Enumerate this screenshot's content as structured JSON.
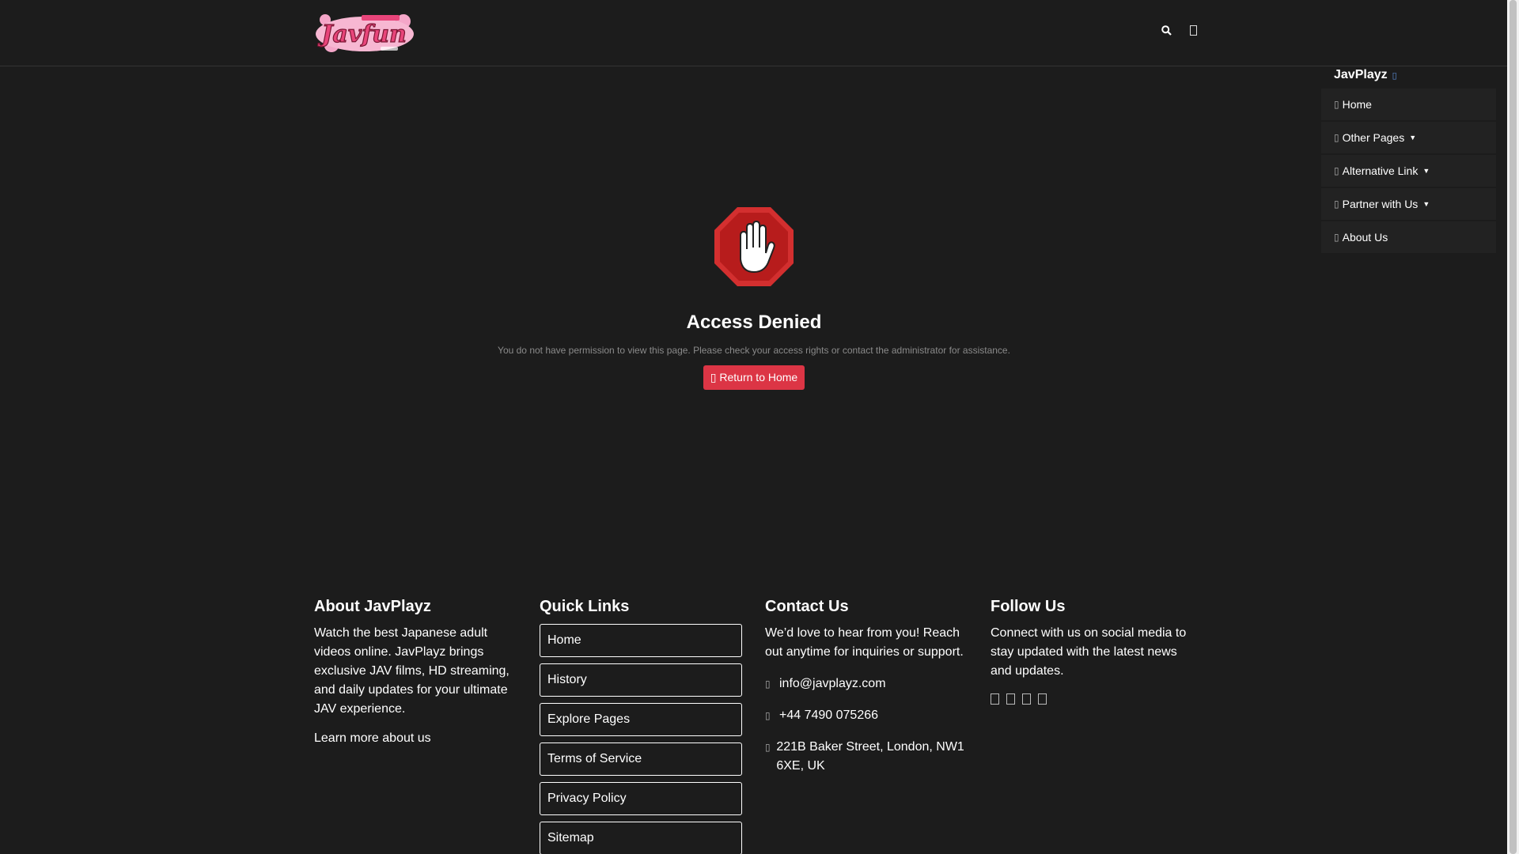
{
  "header": {
    "logo_text": "Javfun",
    "search_icon": "search-icon",
    "menu_icon": "menu-icon"
  },
  "sidebar": {
    "title": "JavPlayz",
    "items": [
      {
        "label": "Home",
        "icon": "home-icon",
        "dropdown": false
      },
      {
        "label": "Other Pages",
        "icon": "pages-icon",
        "dropdown": true
      },
      {
        "label": "Alternative Link",
        "icon": "link-icon",
        "dropdown": true
      },
      {
        "label": "Partner with Us",
        "icon": "handshake-icon",
        "dropdown": true
      },
      {
        "label": "About Us",
        "icon": "info-icon",
        "dropdown": false
      }
    ]
  },
  "main": {
    "title": "Access Denied",
    "message": "You do not have permission to view this page. Please check your access rights or contact the administrator for assistance.",
    "button_label": "Return to Home"
  },
  "footer": {
    "about": {
      "title": "About JavPlayz",
      "text": "Watch the best Japanese adult videos online. JavPlayz brings exclusive JAV films, HD streaming, and daily updates for your ultimate JAV experience.",
      "link": "Learn more about us"
    },
    "quick_links": {
      "title": "Quick Links",
      "items": [
        "Home",
        "History",
        "Explore Pages",
        "Terms of Service",
        "Privacy Policy",
        "Sitemap"
      ]
    },
    "contact": {
      "title": "Contact Us",
      "intro": "We’d love to hear from you! Reach out anytime for inquiries or support.",
      "email": "info@javplayz.com",
      "phone": "+44 7490 075266",
      "address": "221B Baker Street, London, NW1 6XE, UK"
    },
    "follow": {
      "title": "Follow Us",
      "text": "Connect with us on social media to stay updated with the latest news and updates.",
      "icons": [
        "facebook-icon",
        "twitter-icon",
        "instagram-icon",
        "telegram-icon"
      ]
    }
  },
  "colors": {
    "background": "#1c1c1c",
    "accent": "#dc3545",
    "logo_pink": "#e8457a"
  }
}
